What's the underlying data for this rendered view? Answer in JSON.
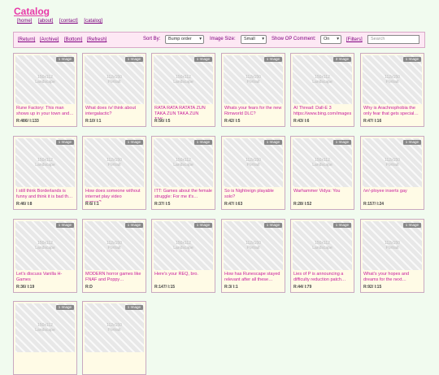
{
  "header": {
    "title": "Catalog"
  },
  "nav": [
    "[home]",
    "[about]",
    "[contact]",
    "[catalog]"
  ],
  "toolbar": {
    "links": [
      "[Return]",
      "[Archive]",
      "[Bottom]",
      "[Refresh]"
    ],
    "sort_label": "Sort By:",
    "sort_value": "Bump order",
    "size_label": "Image Size:",
    "size_value": "Small",
    "op_label": "Show OP Comment:",
    "op_value": "On",
    "filters": "[Filters]",
    "search_placeholder": "Search"
  },
  "threads": [
    {
      "badge": "1 Image",
      "dims": "150x112",
      "orient": "Landscape",
      "title": "Rune Factory: This man shows up in your town and…",
      "stats": "R:486/ I:133"
    },
    {
      "badge": "1 Image",
      "dims": "112x150",
      "orient": "Portrait",
      "title": "What does /v/ think about intergalactic?",
      "stats": "R:10/ I:1"
    },
    {
      "badge": "1 Image",
      "dims": "150x112",
      "orient": "Landscape",
      "title": "RATA RATA RATATA ZUN TAKA ZUN TAKA ZUN TAK…",
      "stats": "R:56/ I:5"
    },
    {
      "badge": "1 Image",
      "dims": "112x150",
      "orient": "Portrait",
      "title": "Whats your fears for the new Rimworld DLC?",
      "stats": "R:42/ I:5"
    },
    {
      "badge": "3 Image",
      "dims": "150x112",
      "orient": "Landscape",
      "title": "AI Thread: Dall-E 3 https://www.bing.com/images",
      "stats": "R:43/ I:6"
    },
    {
      "badge": "1 Image",
      "dims": "112x150",
      "orient": "Portrait",
      "title": "Why is Arachnophobia the only fear that gets special…",
      "stats": "R:47/ I:16"
    },
    {
      "badge": "1 Image",
      "dims": "150x112",
      "orient": "Landscape",
      "title": "I still think Borderlands is funny and think it is bad th…",
      "stats": "R:46/ I:8"
    },
    {
      "badge": "1 Image",
      "dims": "112x150",
      "orient": "Portrait",
      "title": "How does someone without internet play video games?…",
      "stats": "R:6/ I:1"
    },
    {
      "badge": "1 Image",
      "dims": "150x112",
      "orient": "Landscape",
      "title": "ITT: Games about the female struggle: For me it's…",
      "stats": "R:37/ I:5"
    },
    {
      "badge": "1 Image",
      "dims": "112x150",
      "orient": "Portrait",
      "title": "So is Nightreign playable solo?",
      "stats": "R:47/ I:63"
    },
    {
      "badge": "1 Image",
      "dims": "150x112",
      "orient": "Landscape",
      "title": "Warhammer Vidya: You",
      "stats": "R:28/ I:52"
    },
    {
      "badge": "1 Image",
      "dims": "112x150",
      "orient": "Portrait",
      "title": "/vr/-ployee inserts gay",
      "stats": "R:157/ I:24"
    },
    {
      "badge": "1 Image",
      "dims": "150x112",
      "orient": "Landscape",
      "title": "Let's discuss Vanilla H-Games",
      "stats": "R:36/ I:19"
    },
    {
      "badge": "1 Image",
      "dims": "112x150",
      "orient": "Portrait",
      "title": "MODERN horror games like FNAF and Poppy…",
      "stats": "R:D"
    },
    {
      "badge": "1 Image",
      "dims": "150x112",
      "orient": "Landscape",
      "title": "Here's your REQ, bro.",
      "stats": "R:147/ I:15"
    },
    {
      "badge": "1 Image",
      "dims": "112x150",
      "orient": "Portrait",
      "title": "How has Runescape stayed relevant after all these…",
      "stats": "R:3/ I:1"
    },
    {
      "badge": "1 Image",
      "dims": "150x112",
      "orient": "Landscape",
      "title": "Lies of P is announcing a difficulty reduction patch…",
      "stats": "R:44/ I:79"
    },
    {
      "badge": "1 Image",
      "dims": "112x150",
      "orient": "Portrait",
      "title": "What's your hopes and dreams for the next…",
      "stats": "R:92/ I:15"
    },
    {
      "badge": "1 Image",
      "dims": "150x112",
      "orient": "Landscape",
      "title": "",
      "stats": ""
    },
    {
      "badge": "1 Image",
      "dims": "112x150",
      "orient": "Portrait",
      "title": "",
      "stats": ""
    }
  ]
}
